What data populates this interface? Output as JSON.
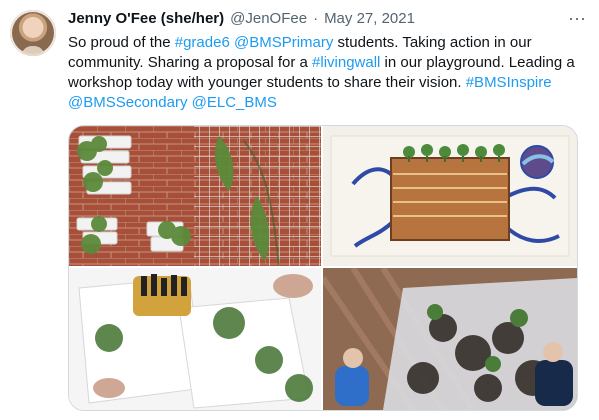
{
  "tweet": {
    "author_name": "Jenny O'Fee (she/her)",
    "author_handle": "@JenOFee",
    "separator": "·",
    "date": "May 27, 2021",
    "more_label": "···",
    "text": {
      "p1": "So proud of the ",
      "hashtag1": "#grade6",
      "p2": " ",
      "mention1": "@BMSPrimary",
      "p3": " students. Taking action in our community. Sharing a proposal for a ",
      "hashtag2": "#livingwall",
      "p4": " in our playground. Leading a workshop today with younger students to share their vision. ",
      "hashtag3": "#BMSInspire",
      "p5": " ",
      "mention2": "@BMSSecondary",
      "p6": " ",
      "mention3": "@ELC_BMS"
    }
  },
  "colors": {
    "link": "#1d9bf0",
    "secondary_text": "#536471",
    "border": "#cfd9de"
  },
  "icons": {
    "more": "more-horizontal-icon"
  }
}
